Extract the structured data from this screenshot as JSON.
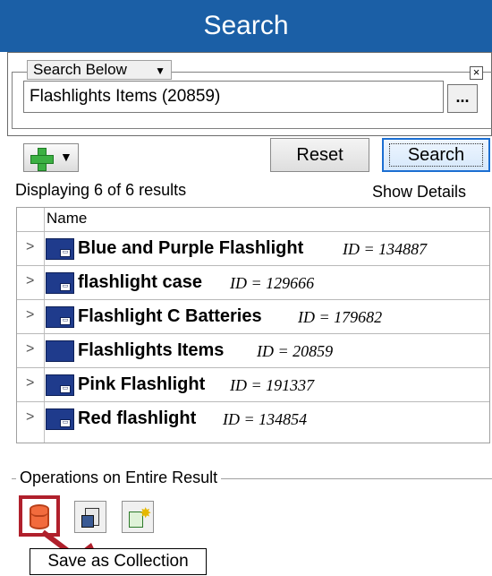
{
  "header": {
    "title": "Search"
  },
  "search_below": {
    "dropdown_label": "Search Below",
    "collection_value": "Flashlights Items (20859)",
    "browse_label": "..."
  },
  "toolbar": {
    "reset_label": "Reset",
    "search_label": "Search"
  },
  "results": {
    "count_text": "Displaying 6 of 6 results",
    "show_details_label": "Show Details",
    "column_header": "Name",
    "rows": [
      {
        "name": "Blue and Purple Flashlight",
        "id": "ID = 134887"
      },
      {
        "name": "flashlight case",
        "id": "ID = 129666"
      },
      {
        "name": "Flashlight C Batteries",
        "id": "ID = 179682"
      },
      {
        "name": "Flashlights Items",
        "id": "ID = 20859"
      },
      {
        "name": "Pink Flashlight",
        "id": "ID = 191337"
      },
      {
        "name": "Red flashlight",
        "id": "ID = 134854"
      }
    ]
  },
  "operations": {
    "group_label": "Operations on Entire Result",
    "tooltip": "Save as Collection"
  },
  "colors": {
    "title_bar": "#1b5fa6",
    "highlight": "#b0202c",
    "item_icon": "#1f3b8c"
  }
}
